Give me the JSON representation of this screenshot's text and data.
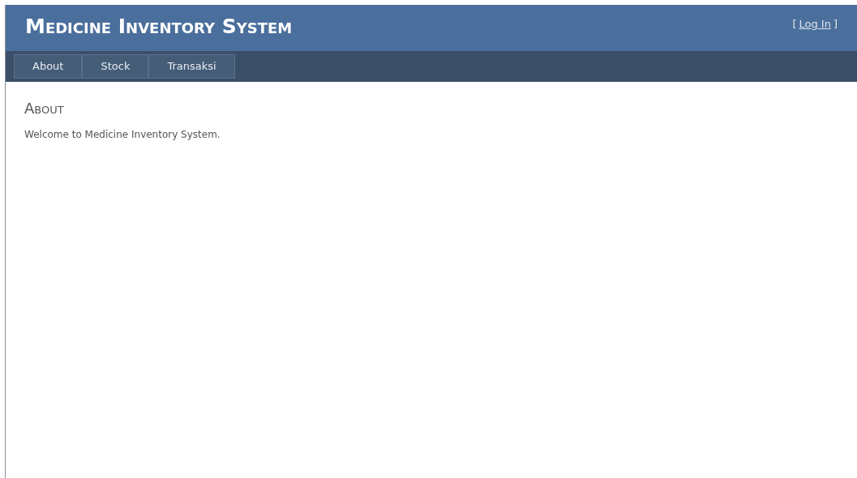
{
  "header": {
    "title": "Medicine Inventory System",
    "login": {
      "open": "[",
      "link": "Log In",
      "close": "]"
    }
  },
  "nav": [
    "About",
    "Stock",
    "Transaksi"
  ],
  "content": {
    "heading": "About",
    "text": "Welcome to Medicine Inventory System."
  }
}
